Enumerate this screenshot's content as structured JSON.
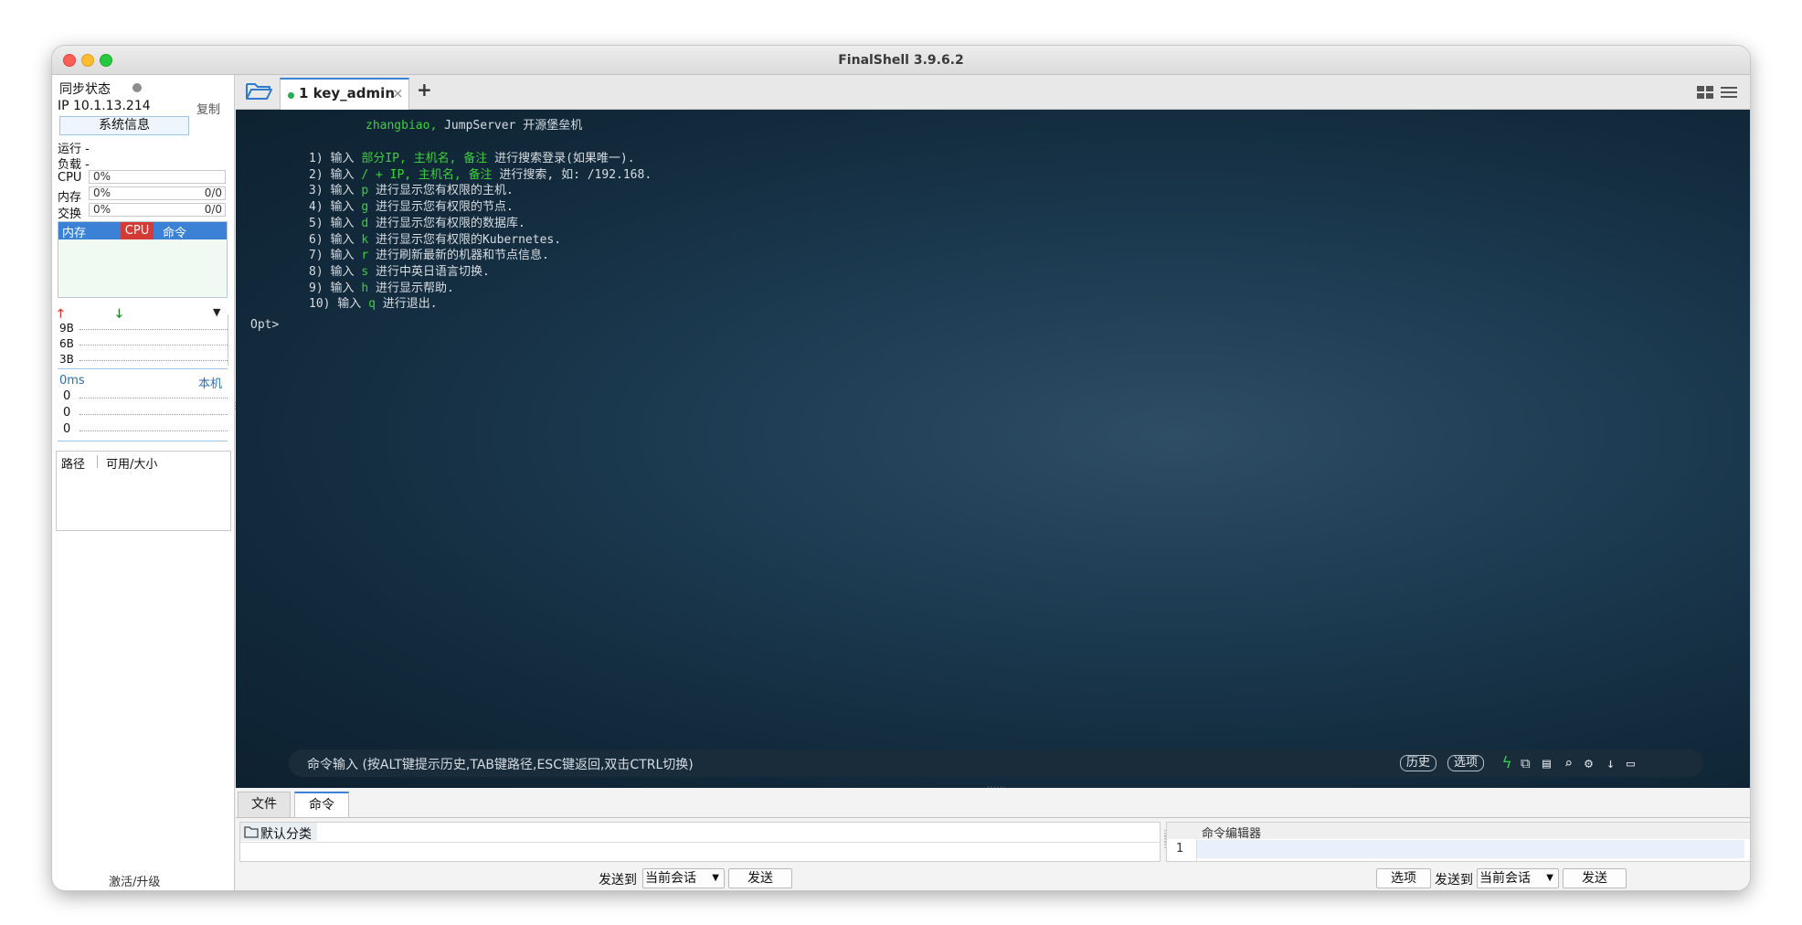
{
  "window": {
    "title": "FinalShell 3.9.6.2"
  },
  "sidebar": {
    "sync_label": "同步状态",
    "ip": "IP 10.1.13.214",
    "copy_label": "复制",
    "sysinfo_button": "系统信息",
    "run_label": "运行 -",
    "load_label": "负载 -",
    "cpu": {
      "label": "CPU",
      "value": "0%"
    },
    "mem": {
      "label": "内存",
      "value": "0%",
      "ratio": "0/0"
    },
    "swap": {
      "label": "交换",
      "value": "0%",
      "ratio": "0/0"
    },
    "process_tabs": [
      "内存",
      "CPU",
      "命令"
    ],
    "net_ticks": [
      "9B",
      "6B",
      "3B"
    ],
    "ping_label": "0ms",
    "ping_host": "本机",
    "ping_values": [
      "0",
      "0",
      "0"
    ],
    "disk_headers": [
      "路径",
      "可用/大小"
    ],
    "activate_label": "激活/升级"
  },
  "tabs": [
    {
      "label": "1 key_admin",
      "close": "×"
    }
  ],
  "add_tab": "+",
  "terminal": {
    "header_green": "zhangbiao,",
    "header_white": " JumpServer 开源堡垒机",
    "lines": [
      {
        "pre": "1) 输入 ",
        "green": "部分IP, 主机名, 备注",
        "post": " 进行搜索登录(如果唯一)."
      },
      {
        "pre": "2) 输入 ",
        "green": "/ + IP, 主机名, 备注",
        "post": " 进行搜索, 如: /192.168."
      },
      {
        "pre": "3) 输入 ",
        "green": "p",
        "post": " 进行显示您有权限的主机."
      },
      {
        "pre": "4) 输入 ",
        "green": "g",
        "post": " 进行显示您有权限的节点."
      },
      {
        "pre": "5) 输入 ",
        "green": "d",
        "post": " 进行显示您有权限的数据库."
      },
      {
        "pre": "6) 输入 ",
        "green": "k",
        "post": " 进行显示您有权限的Kubernetes."
      },
      {
        "pre": "7) 输入 ",
        "green": "r",
        "post": " 进行刷新最新的机器和节点信息."
      },
      {
        "pre": "8) 输入 ",
        "green": "s",
        "post": " 进行中英日语言切换."
      },
      {
        "pre": "9) 输入 ",
        "green": "h",
        "post": " 进行显示帮助."
      },
      {
        "pre": "10) 输入 ",
        "green": "q",
        "post": " 进行退出."
      }
    ],
    "prompt": "Opt>"
  },
  "cmdbar": {
    "placeholder": "命令输入 (按ALT键提示历史,TAB键路径,ESC键返回,双击CTRL切换)",
    "history_label": "历史",
    "options_label": "选项"
  },
  "bottom": {
    "tabs": [
      "文件",
      "命令"
    ],
    "category": "默认分类",
    "send_to_label": "发送到",
    "session_value": "当前会话",
    "send_label": "发送",
    "editor_title": "命令编辑器",
    "line_number": "1",
    "options_label": "选项"
  },
  "colors": {
    "accent_blue": "#3b82d6",
    "cpu_red": "#d43a36",
    "terminal_green": "#3ecf3e"
  }
}
